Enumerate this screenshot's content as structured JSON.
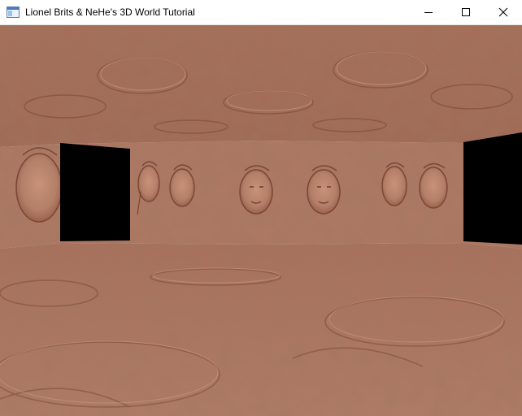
{
  "window": {
    "title": "Lionel Brits & NeHe's 3D World Tutorial",
    "controls": {
      "minimize_icon": "minimize-icon",
      "maximize_icon": "maximize-icon",
      "close_icon": "close-icon"
    }
  },
  "scene": {
    "description_icons": [
      "app-icon"
    ],
    "colors": {
      "wall": "#b07a62",
      "wall_dark": "#8a5642",
      "floor": "#ad7661",
      "ceiling": "#a36e58",
      "doorway": "#000000"
    }
  }
}
